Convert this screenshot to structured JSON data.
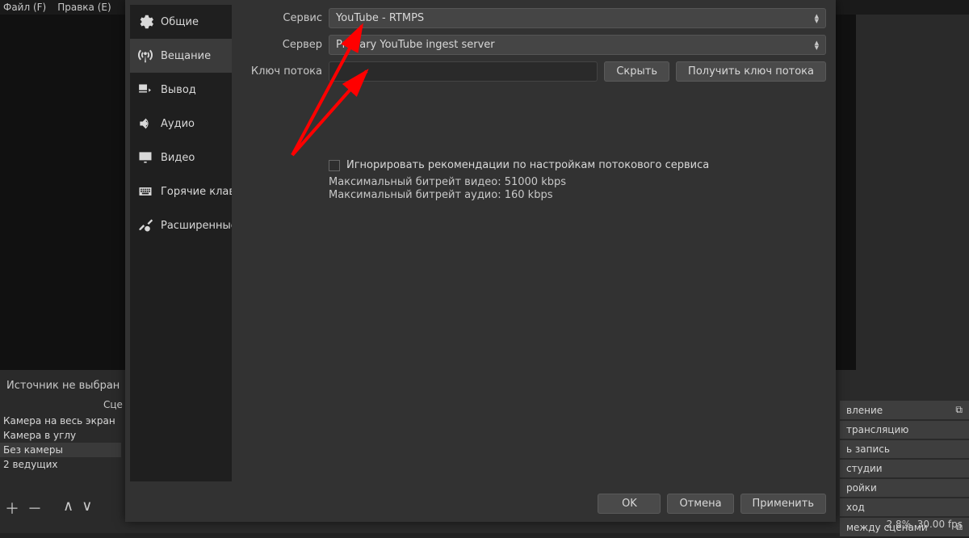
{
  "menubar": {
    "file": "Файл (F)",
    "edit": "Правка (E)"
  },
  "main": {
    "no_source": "Источник не выбран",
    "scene_label": "Сце",
    "scenes": [
      "Камера на весь экран",
      "Камера в углу",
      "Без камеры",
      "2 ведущих"
    ],
    "tools_add": "＋",
    "tools_remove": "－",
    "tools_up": "∧",
    "tools_down": "∨"
  },
  "rightcol": {
    "header": "вление",
    "buttons": [
      "трансляцию",
      "ь запись",
      "студии",
      "ройки",
      "ход"
    ],
    "transitions": "между сценами",
    "stats": "2.8%, 30.00 fps"
  },
  "dialog": {
    "sidebar": {
      "items": [
        {
          "label": "Общие"
        },
        {
          "label": "Вещание"
        },
        {
          "label": "Вывод"
        },
        {
          "label": "Аудио"
        },
        {
          "label": "Видео"
        },
        {
          "label": "Горячие клави"
        },
        {
          "label": "Расширенные"
        }
      ]
    },
    "labels": {
      "service": "Сервис",
      "server": "Сервер",
      "stream_key": "Ключ потока"
    },
    "values": {
      "service": "YouTube - RTMPS",
      "server": "Primary YouTube ingest server",
      "stream_key": ""
    },
    "buttons": {
      "hide": "Скрыть",
      "get_key": "Получить ключ потока",
      "ok": "OK",
      "cancel": "Отмена",
      "apply": "Применить"
    },
    "checkbox_label": "Игнорировать рекомендации по настройкам потокового сервиса",
    "info": {
      "line1": "Максимальный битрейт видео: 51000 kbps",
      "line2": "Максимальный битрейт аудио: 160 kbps"
    }
  }
}
